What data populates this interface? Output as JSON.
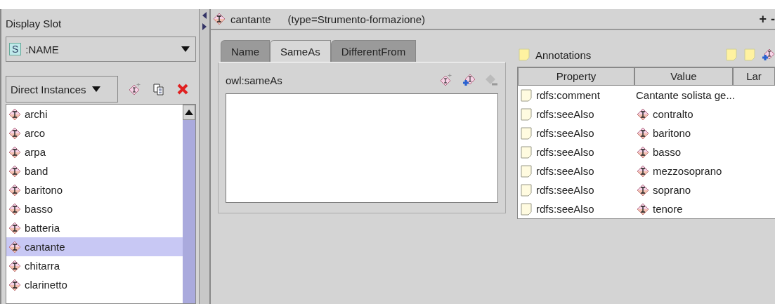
{
  "left": {
    "display_slot": {
      "label": "Display Slot",
      "value": ":NAME",
      "slot_badge": "S"
    },
    "instances_mode": "Direct Instances",
    "instances": [
      {
        "name": "archi",
        "selected": false
      },
      {
        "name": "arco",
        "selected": false
      },
      {
        "name": "arpa",
        "selected": false
      },
      {
        "name": "band",
        "selected": false
      },
      {
        "name": "baritono",
        "selected": false
      },
      {
        "name": "basso",
        "selected": false
      },
      {
        "name": "batteria",
        "selected": false
      },
      {
        "name": "cantante",
        "selected": true
      },
      {
        "name": "chitarra",
        "selected": false
      },
      {
        "name": "clarinetto",
        "selected": false
      }
    ]
  },
  "header": {
    "name": "cantante",
    "type": "(type=Strumento-formazione)",
    "plus": "+",
    "minus": "-"
  },
  "tabs": [
    {
      "label": "Name",
      "selected": false
    },
    {
      "label": "SameAs",
      "selected": true
    },
    {
      "label": "DifferentFrom",
      "selected": false
    }
  ],
  "same_as": {
    "label": "owl:sameAs"
  },
  "annotations": {
    "title": "Annotations",
    "columns": [
      "Property",
      "Value",
      "Lar"
    ],
    "rows": [
      {
        "property": "rdfs:comment",
        "value": "Cantante  solista ge...",
        "kind": "text"
      },
      {
        "property": "rdfs:seeAlso",
        "value": "contralto",
        "kind": "instance"
      },
      {
        "property": "rdfs:seeAlso",
        "value": "baritono",
        "kind": "instance"
      },
      {
        "property": "rdfs:seeAlso",
        "value": "basso",
        "kind": "instance"
      },
      {
        "property": "rdfs:seeAlso",
        "value": "mezzosoprano",
        "kind": "instance"
      },
      {
        "property": "rdfs:seeAlso",
        "value": "soprano",
        "kind": "instance"
      },
      {
        "property": "rdfs:seeAlso",
        "value": "tenore",
        "kind": "instance"
      }
    ]
  }
}
